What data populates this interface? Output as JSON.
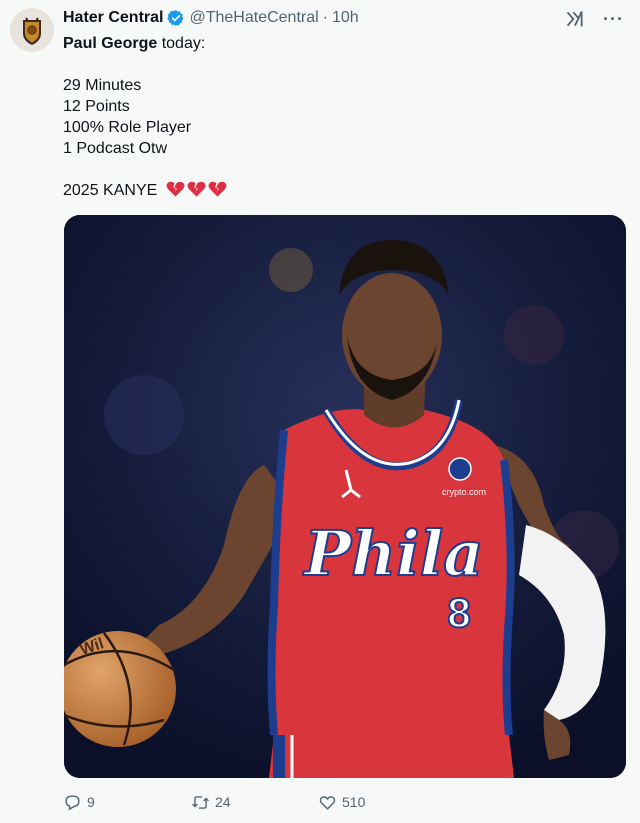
{
  "tweet": {
    "author_name": "Hater Central",
    "handle": "@TheHateCentral",
    "separator": "·",
    "time": "10h",
    "subject_bold": "Paul George",
    "subject_rest": " today:",
    "stats": [
      "29 Minutes",
      "12 Points",
      "100% Role Player",
      "1 Podcast Otw"
    ],
    "closing_text": "2025 KANYE",
    "closing_emoji": "broken-heart-icon x3"
  },
  "photo": {
    "jersey_wordmark": "Phila",
    "jersey_number": "8",
    "jersey_sponsor": "crypto.com",
    "ball_text": "Wil"
  },
  "actions": {
    "replies": "9",
    "retweets": "24",
    "likes": "510"
  },
  "colors": {
    "background": "#f7f9f9",
    "text": "#0f1419",
    "muted": "#536471",
    "verified": "#1d9bf0",
    "jersey_red": "#d9353d",
    "jersey_blue": "#1d3d8f",
    "heart": "#e0245e"
  },
  "icons": [
    "verified-badge-icon",
    "grok-icon",
    "more-icon",
    "reply-icon",
    "retweet-icon",
    "like-icon"
  ]
}
